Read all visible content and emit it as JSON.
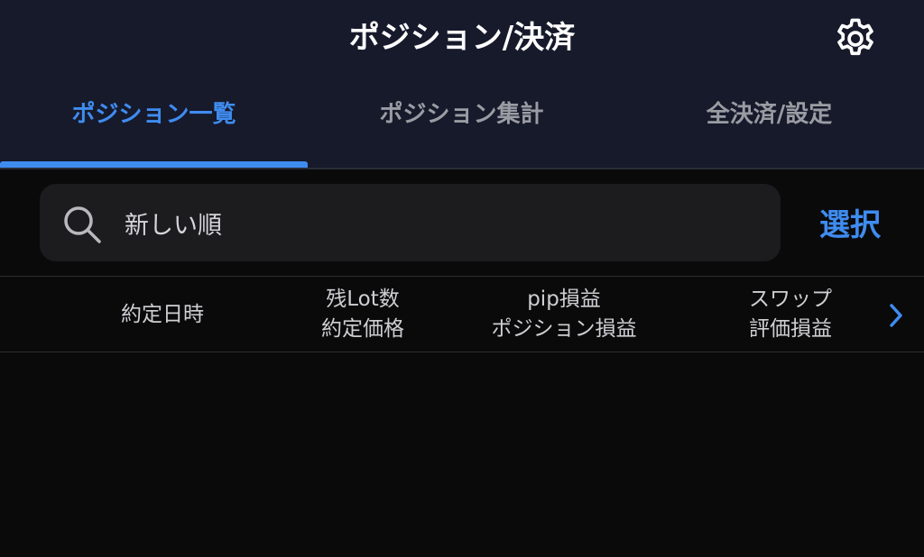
{
  "header": {
    "title": "ポジション/決済",
    "settings_icon": "gear-icon"
  },
  "tabs": [
    {
      "label": "ポジション一覧",
      "active": true
    },
    {
      "label": "ポジション集計",
      "active": false
    },
    {
      "label": "全決済/設定",
      "active": false
    }
  ],
  "search": {
    "icon": "search-icon",
    "value": "新しい順"
  },
  "select_label": "選択",
  "columns": {
    "col1": {
      "line1": "約定日時"
    },
    "col2": {
      "line1": "残Lot数",
      "line2": "約定価格"
    },
    "col3": {
      "line1": "pip損益",
      "line2": "ポジション損益"
    },
    "col4": {
      "line1": "スワップ",
      "line2": "評価損益"
    },
    "next_icon": "chevron-right-icon"
  },
  "colors": {
    "accent": "#3f8cf0",
    "header_bg": "#161a2b",
    "body_bg": "#0a0a0b",
    "search_bg": "#1c1c1f"
  }
}
